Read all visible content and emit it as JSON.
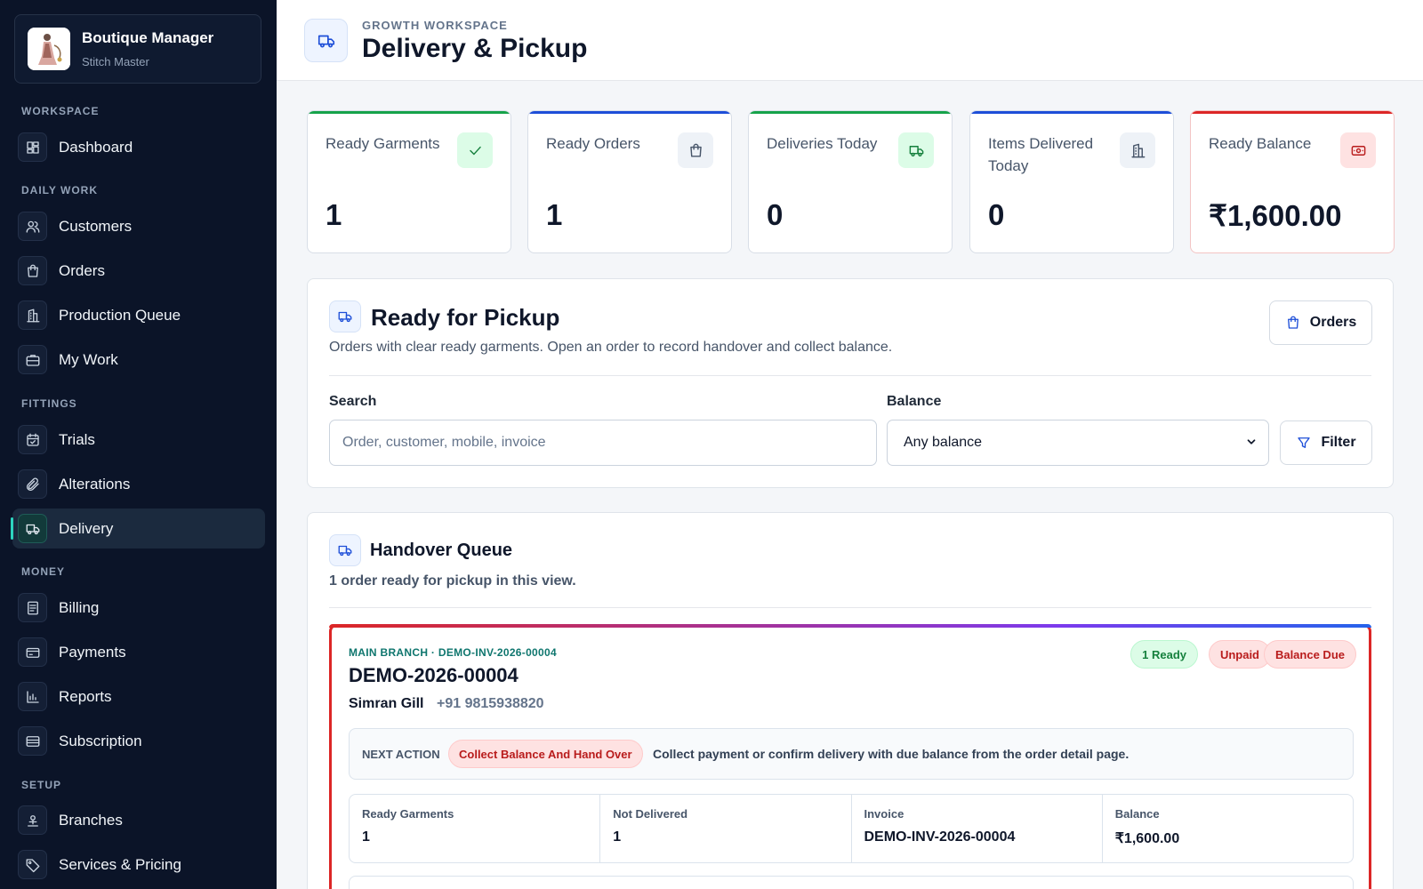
{
  "app": {
    "name": "Boutique Manager",
    "subtitle": "Stitch Master"
  },
  "sidebar": {
    "sections": {
      "workspace": "WORKSPACE",
      "daily": "DAILY WORK",
      "fittings": "FITTINGS",
      "money": "MONEY",
      "setup": "SETUP"
    },
    "items": {
      "dashboard": "Dashboard",
      "customers": "Customers",
      "orders": "Orders",
      "production": "Production Queue",
      "mywork": "My Work",
      "trials": "Trials",
      "alterations": "Alterations",
      "delivery": "Delivery",
      "billing": "Billing",
      "payments": "Payments",
      "reports": "Reports",
      "subscription": "Subscription",
      "branches": "Branches",
      "services": "Services & Pricing"
    },
    "active": "delivery",
    "active_accent": "#2dd4bf"
  },
  "header": {
    "overline": "GROWTH WORKSPACE",
    "title": "Delivery & Pickup"
  },
  "stats": [
    {
      "label": "Ready Garments",
      "value": "1",
      "accent": "#16a34a",
      "icon": "check-icon"
    },
    {
      "label": "Ready Orders",
      "value": "1",
      "accent": "#1d4ed8",
      "icon": "shopping-bag-icon"
    },
    {
      "label": "Deliveries Today",
      "value": "0",
      "accent": "#16a34a",
      "icon": "truck-icon"
    },
    {
      "label": "Items Delivered Today",
      "value": "0",
      "accent": "#1d4ed8",
      "icon": "building-icon"
    },
    {
      "label": "Ready Balance",
      "value": "₹1,600.00",
      "accent": "#dc2626",
      "icon": "banknote-icon"
    }
  ],
  "pickup": {
    "title": "Ready for Pickup",
    "description": "Orders with clear ready garments. Open an order to record handover and collect balance.",
    "orders_button": "Orders",
    "search_label": "Search",
    "search_placeholder": "Order, customer, mobile, invoice",
    "balance_label": "Balance",
    "balance_value": "Any balance",
    "filter_button": "Filter"
  },
  "queue": {
    "title": "Handover Queue",
    "subtitle": "1 order ready for pickup in this view.",
    "order": {
      "meta": "MAIN BRANCH · DEMO-INV-2026-00004",
      "number": "DEMO-2026-00004",
      "customer": "Simran Gill",
      "phone": "+91 9815938820",
      "badges": {
        "ready": "1 Ready",
        "unpaid": "Unpaid",
        "balance_due": "Balance Due"
      },
      "next_action_label": "NEXT ACTION",
      "next_action_pill": "Collect Balance And Hand Over",
      "next_action_text": "Collect payment or confirm delivery with due balance from the order detail page.",
      "fields": [
        {
          "label": "Ready Garments",
          "value": "1"
        },
        {
          "label": "Not Delivered",
          "value": "1"
        },
        {
          "label": "Invoice",
          "value": "DEMO-INV-2026-00004"
        },
        {
          "label": "Balance",
          "value": "₹1,600.00"
        }
      ]
    }
  }
}
